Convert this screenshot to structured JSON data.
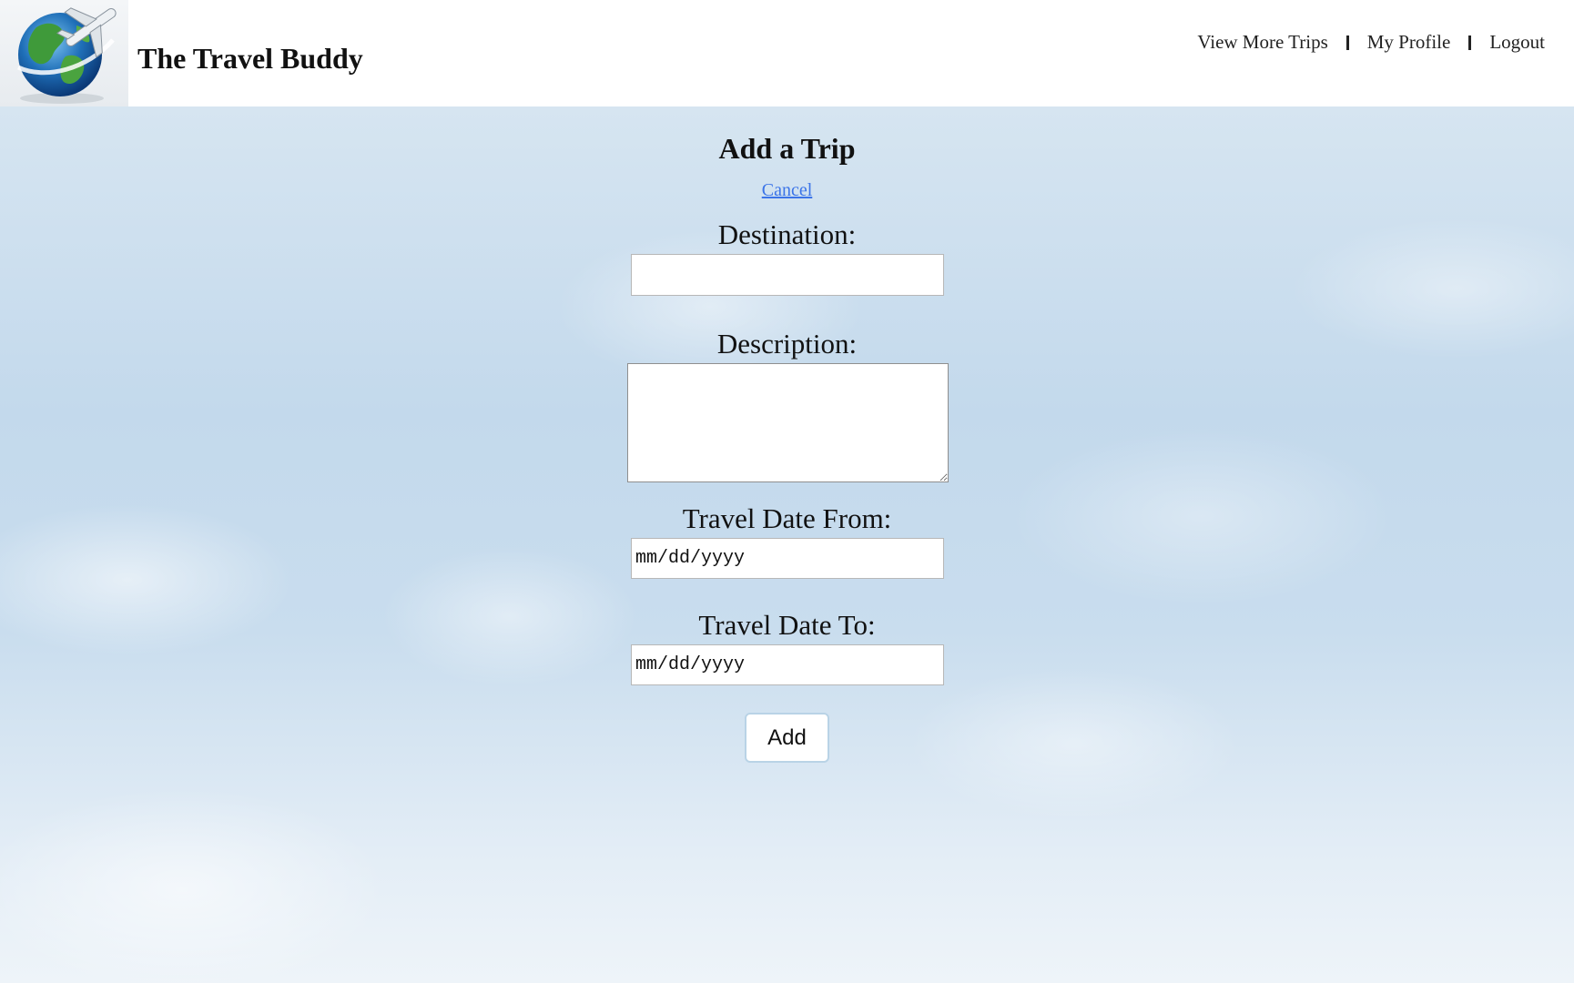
{
  "header": {
    "site_title": "The Travel Buddy",
    "nav": {
      "view_more_trips": "View More Trips",
      "my_profile": "My Profile",
      "logout": "Logout"
    }
  },
  "form": {
    "title": "Add a Trip",
    "cancel_label": "Cancel",
    "destination": {
      "label": "Destination:",
      "value": ""
    },
    "description": {
      "label": "Description:",
      "value": ""
    },
    "date_from": {
      "label": "Travel Date From:",
      "placeholder": "mm/dd/yyyy"
    },
    "date_to": {
      "label": "Travel Date To:",
      "placeholder": "mm/dd/yyyy"
    },
    "submit_label": "Add"
  },
  "colors": {
    "link": "#3b74e8",
    "header_bg": "#ffffff",
    "sky": "#c9dced"
  },
  "icons": {
    "logo": "globe-airplane-icon"
  }
}
